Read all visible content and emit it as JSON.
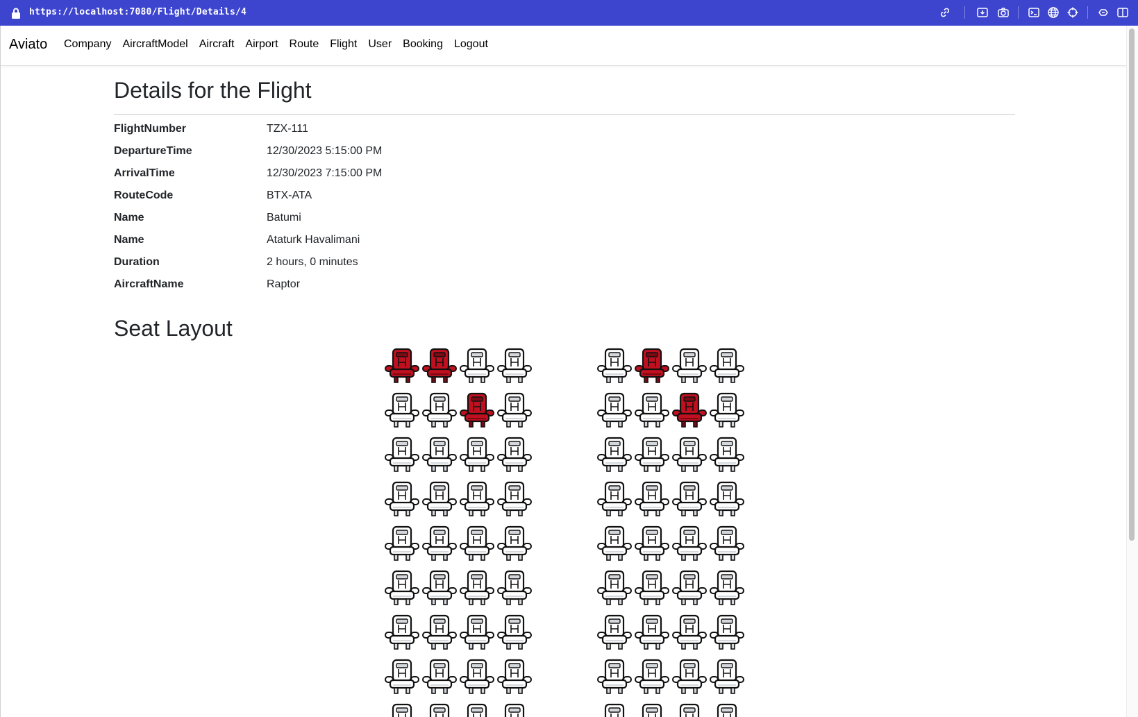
{
  "browser": {
    "url": "https://localhost:7080/Flight/Details/4",
    "toolbar_icons": [
      "link-icon",
      "download-icon",
      "camera-icon",
      "terminal-icon",
      "globe-icon",
      "crosshair-icon",
      "extensions-icon",
      "sidebar-icon"
    ]
  },
  "navbar": {
    "brand": "Aviato",
    "links": [
      "Company",
      "AircraftModel",
      "Aircraft",
      "Airport",
      "Route",
      "Flight",
      "User",
      "Booking",
      "Logout"
    ]
  },
  "page": {
    "title": "Details for the Flight",
    "details": [
      {
        "label": "FlightNumber",
        "value": "TZX-111"
      },
      {
        "label": "DepartureTime",
        "value": "12/30/2023 5:15:00 PM"
      },
      {
        "label": "ArrivalTime",
        "value": "12/30/2023 7:15:00 PM"
      },
      {
        "label": "RouteCode",
        "value": "BTX-ATA"
      },
      {
        "label": "Name",
        "value": "Batumi"
      },
      {
        "label": "Name",
        "value": "Ataturk Havalimani"
      },
      {
        "label": "Duration",
        "value": "2 hours, 0 minutes"
      },
      {
        "label": "AircraftName",
        "value": "Raptor"
      }
    ],
    "seat_section_title": "Seat Layout"
  },
  "seat_layout": {
    "seats_per_row": 8,
    "aisle_after_seat": 4,
    "visible_rows": 9,
    "occupied": [
      [
        0,
        0
      ],
      [
        0,
        1
      ],
      [
        0,
        5
      ],
      [
        1,
        2
      ],
      [
        1,
        6
      ]
    ],
    "colors": {
      "occupied": "#c0101f",
      "occupied_dark": "#7a0a14",
      "free": "#ffffff",
      "outline": "#111111"
    }
  }
}
